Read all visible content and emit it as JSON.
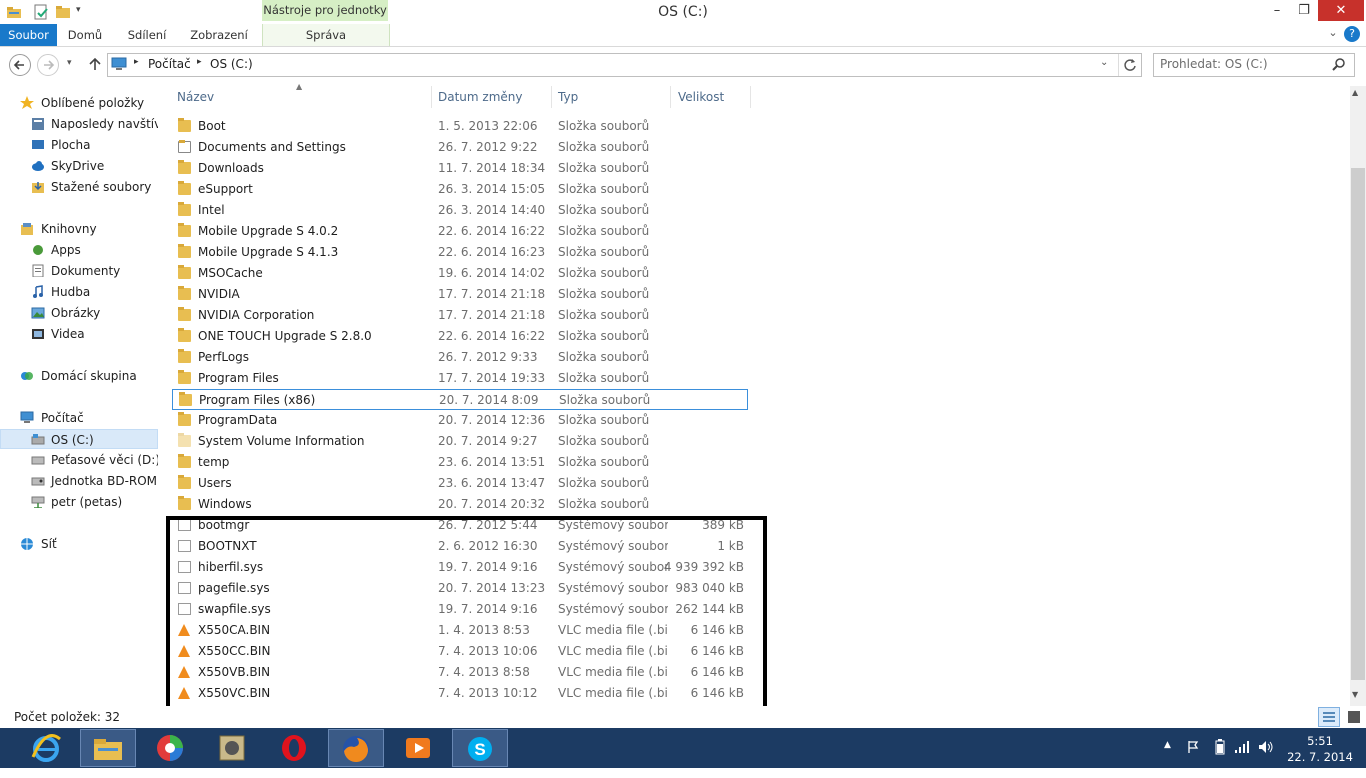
{
  "window": {
    "title": "OS (C:)",
    "min": "–",
    "max": "❐",
    "close": "✕"
  },
  "ribbon": {
    "contextual_group": "Nástroje pro jednotky",
    "tabs": {
      "file": "Soubor",
      "home": "Domů",
      "share": "Sdílení",
      "view": "Zobrazení",
      "manage": "Správa"
    },
    "help": "?",
    "expand": "⌄"
  },
  "address": {
    "path": [
      "Počítač",
      "OS (C:)"
    ],
    "separator": "▸",
    "search_placeholder": "Prohledat: OS (C:)"
  },
  "nav": {
    "favorites": {
      "label": "Oblíbené položky",
      "items": [
        "Naposledy navštívené",
        "Plocha",
        "SkyDrive",
        "Stažené soubory"
      ]
    },
    "libraries": {
      "label": "Knihovny",
      "items": [
        "Apps",
        "Dokumenty",
        "Hudba",
        "Obrázky",
        "Videa"
      ]
    },
    "homegroup": "Domácí skupina",
    "computer": {
      "label": "Počítač",
      "items": [
        "OS (C:)",
        "Peťasové věci (D:)",
        "Jednotka BD-ROM (E:)",
        "petr (petas)"
      ]
    },
    "network": "Síť"
  },
  "columns": {
    "name": "Název",
    "date": "Datum změny",
    "type": "Typ",
    "size": "Velikost"
  },
  "files": [
    {
      "name": "Boot",
      "date": "1. 5. 2013 22:06",
      "type": "Složka souborů",
      "size": "",
      "kind": "folder"
    },
    {
      "name": "Documents and Settings",
      "date": "26. 7. 2012 9:22",
      "type": "Složka souborů",
      "size": "",
      "kind": "link"
    },
    {
      "name": "Downloads",
      "date": "11. 7. 2014 18:34",
      "type": "Složka souborů",
      "size": "",
      "kind": "folder"
    },
    {
      "name": "eSupport",
      "date": "26. 3. 2014 15:05",
      "type": "Složka souborů",
      "size": "",
      "kind": "folder"
    },
    {
      "name": "Intel",
      "date": "26. 3. 2014 14:40",
      "type": "Složka souborů",
      "size": "",
      "kind": "folder"
    },
    {
      "name": "Mobile Upgrade S 4.0.2",
      "date": "22. 6. 2014 16:22",
      "type": "Složka souborů",
      "size": "",
      "kind": "folder"
    },
    {
      "name": "Mobile Upgrade S 4.1.3",
      "date": "22. 6. 2014 16:23",
      "type": "Složka souborů",
      "size": "",
      "kind": "folder"
    },
    {
      "name": "MSOCache",
      "date": "19. 6. 2014 14:02",
      "type": "Složka souborů",
      "size": "",
      "kind": "folder"
    },
    {
      "name": "NVIDIA",
      "date": "17. 7. 2014 21:18",
      "type": "Složka souborů",
      "size": "",
      "kind": "folder"
    },
    {
      "name": "NVIDIA Corporation",
      "date": "17. 7. 2014 21:18",
      "type": "Složka souborů",
      "size": "",
      "kind": "folder"
    },
    {
      "name": "ONE TOUCH Upgrade S 2.8.0",
      "date": "22. 6. 2014 16:22",
      "type": "Složka souborů",
      "size": "",
      "kind": "folder"
    },
    {
      "name": "PerfLogs",
      "date": "26. 7. 2012 9:33",
      "type": "Složka souborů",
      "size": "",
      "kind": "folder"
    },
    {
      "name": "Program Files",
      "date": "17. 7. 2014 19:33",
      "type": "Složka souborů",
      "size": "",
      "kind": "folder"
    },
    {
      "name": "Program Files (x86)",
      "date": "20. 7. 2014 8:09",
      "type": "Složka souborů",
      "size": "",
      "kind": "folder",
      "selected": true
    },
    {
      "name": "ProgramData",
      "date": "20. 7. 2014 12:36",
      "type": "Složka souborů",
      "size": "",
      "kind": "folder"
    },
    {
      "name": "System Volume Information",
      "date": "20. 7. 2014 9:27",
      "type": "Složka souborů",
      "size": "",
      "kind": "folder"
    },
    {
      "name": "temp",
      "date": "23. 6. 2014 13:51",
      "type": "Složka souborů",
      "size": "",
      "kind": "folder"
    },
    {
      "name": "Users",
      "date": "23. 6. 2014 13:47",
      "type": "Složka souborů",
      "size": "",
      "kind": "folder"
    },
    {
      "name": "Windows",
      "date": "20. 7. 2014 20:32",
      "type": "Složka souborů",
      "size": "",
      "kind": "folder"
    },
    {
      "name": "bootmgr",
      "date": "26. 7. 2012 5:44",
      "type": "Systémový soubor",
      "size": "389 kB",
      "kind": "sys"
    },
    {
      "name": "BOOTNXT",
      "date": "2. 6. 2012 16:30",
      "type": "Systémový soubor",
      "size": "1 kB",
      "kind": "sys"
    },
    {
      "name": "hiberfil.sys",
      "date": "19. 7. 2014 9:16",
      "type": "Systémový soubor",
      "size": "4 939 392 kB",
      "kind": "sys"
    },
    {
      "name": "pagefile.sys",
      "date": "20. 7. 2014 13:23",
      "type": "Systémový soubor",
      "size": "983 040 kB",
      "kind": "sys"
    },
    {
      "name": "swapfile.sys",
      "date": "19. 7. 2014 9:16",
      "type": "Systémový soubor",
      "size": "262 144 kB",
      "kind": "sys"
    },
    {
      "name": "X550CA.BIN",
      "date": "1. 4. 2013 8:53",
      "type": "VLC media file (.bi...",
      "size": "6 146 kB",
      "kind": "vlc"
    },
    {
      "name": "X550CC.BIN",
      "date": "7. 4. 2013 10:06",
      "type": "VLC media file (.bi...",
      "size": "6 146 kB",
      "kind": "vlc"
    },
    {
      "name": "X550VB.BIN",
      "date": "7. 4. 2013 8:58",
      "type": "VLC media file (.bi...",
      "size": "6 146 kB",
      "kind": "vlc"
    },
    {
      "name": "X550VC.BIN",
      "date": "7. 4. 2013 10:12",
      "type": "VLC media file (.bi...",
      "size": "6 146 kB",
      "kind": "vlc"
    }
  ],
  "status": {
    "item_count": "Počet položek: 32"
  },
  "taskbar": {
    "apps": [
      "internet-explorer-icon",
      "file-explorer-icon",
      "picasa-icon",
      "archive-icon",
      "opera-icon",
      "firefox-icon",
      "media-player-icon",
      "skype-icon"
    ],
    "time": "5:51",
    "date": "22. 7. 2014"
  },
  "colors": {
    "accent": "#1979ca",
    "taskbar": "#1c3b63",
    "folder": "#e8be51",
    "highlight_border": "#000000",
    "selection": "#3b8fdb"
  }
}
